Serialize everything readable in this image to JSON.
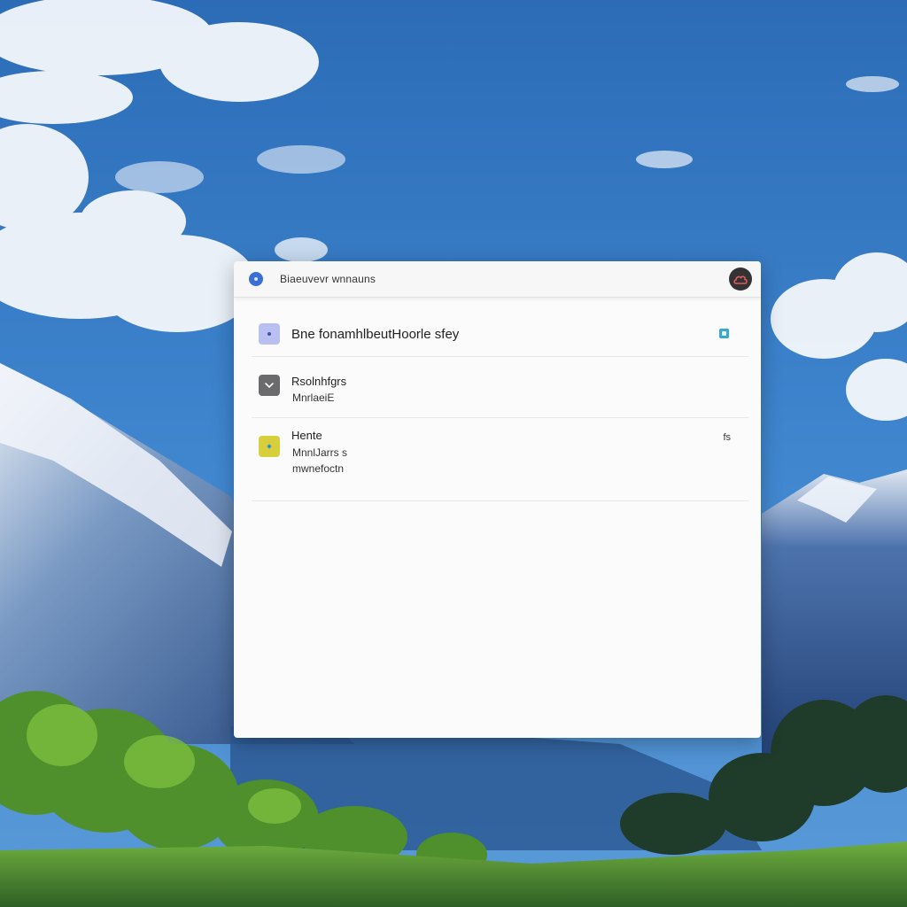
{
  "window": {
    "title": "Biaeuvevr wnnauns"
  },
  "rows": [
    {
      "title": "Bne fonamhlbeutHoorle sfey",
      "icon": "circle-dot-icon",
      "badge_icon": "square-badge-icon"
    },
    {
      "title": "Rsolnhfgrs",
      "subtitle": "MnrlaeiE",
      "icon": "chevron-down-icon"
    },
    {
      "title": "Hente",
      "subtitle_1": "MnnlJarrs s",
      "subtitle_2": "mwnefoctn",
      "meta": "fs",
      "icon": "dot-icon"
    }
  ],
  "colors": {
    "window_bg": "#fbfbfb",
    "row1_icon": "#b9bff0",
    "row2_icon": "#6b6b6e",
    "row3_icon": "#d7cf3c",
    "accent_blue": "#3a6fd8",
    "badge": "#3ba7cf"
  }
}
